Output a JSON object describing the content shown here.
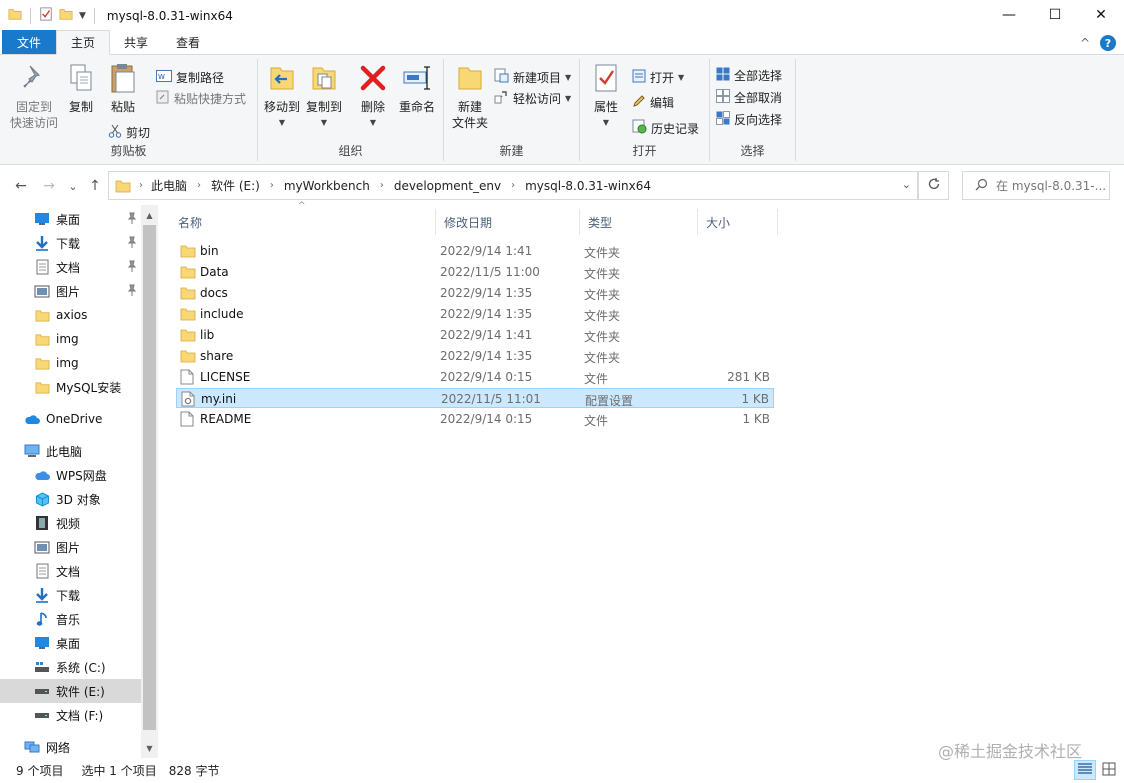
{
  "window": {
    "title": "mysql-8.0.31-winx64",
    "minimize": "—",
    "maximize": "☐",
    "close": "✕"
  },
  "tabs": {
    "file": "文件",
    "home": "主页",
    "share": "共享",
    "view": "查看",
    "collapse": "^",
    "help": "?"
  },
  "ribbon": {
    "clipboard": {
      "label": "剪贴板",
      "pin": "固定到快速访问",
      "pin_l1": "固定到",
      "pin_l2": "快速访问",
      "copy": "复制",
      "paste": "粘贴",
      "copy_path": "复制路径",
      "paste_shortcut": "粘贴快捷方式",
      "cut": "剪切"
    },
    "organize": {
      "label": "组织",
      "move_to": "移动到",
      "copy_to": "复制到",
      "delete": "删除",
      "rename": "重命名"
    },
    "new": {
      "label": "新建",
      "new_folder_l1": "新建",
      "new_folder_l2": "文件夹",
      "new_item": "新建项目",
      "easy_access": "轻松访问"
    },
    "open": {
      "label": "打开",
      "properties": "属性",
      "open": "打开",
      "edit": "编辑",
      "history": "历史记录"
    },
    "select": {
      "label": "选择",
      "select_all": "全部选择",
      "select_none": "全部取消",
      "invert": "反向选择"
    }
  },
  "address": {
    "back": "←",
    "forward": "→",
    "recent": "⌄",
    "up": "↑",
    "crumbs": [
      "此电脑",
      "软件 (E:)",
      "myWorkbench",
      "development_env",
      "mysql-8.0.31-winx64"
    ],
    "search_placeholder": "在 mysql-8.0.31-..."
  },
  "nav": {
    "quick": [
      "桌面",
      "下载",
      "文档",
      "图片",
      "axios",
      "img",
      "img",
      "MySQL安装"
    ],
    "onedrive": "OneDrive",
    "this_pc": "此电脑",
    "pc_items": [
      "WPS网盘",
      "3D 对象",
      "视频",
      "图片",
      "文档",
      "下载",
      "音乐",
      "桌面",
      "系统 (C:)",
      "软件 (E:)",
      "文档 (F:)"
    ],
    "network": "网络"
  },
  "columns": {
    "name": "名称",
    "date": "修改日期",
    "type": "类型",
    "size": "大小"
  },
  "files": [
    {
      "name": "bin",
      "date": "2022/9/14 1:41",
      "type": "文件夹",
      "size": "",
      "kind": "folder"
    },
    {
      "name": "Data",
      "date": "2022/11/5 11:00",
      "type": "文件夹",
      "size": "",
      "kind": "folder"
    },
    {
      "name": "docs",
      "date": "2022/9/14 1:35",
      "type": "文件夹",
      "size": "",
      "kind": "folder"
    },
    {
      "name": "include",
      "date": "2022/9/14 1:35",
      "type": "文件夹",
      "size": "",
      "kind": "folder"
    },
    {
      "name": "lib",
      "date": "2022/9/14 1:41",
      "type": "文件夹",
      "size": "",
      "kind": "folder"
    },
    {
      "name": "share",
      "date": "2022/9/14 1:35",
      "type": "文件夹",
      "size": "",
      "kind": "folder"
    },
    {
      "name": "LICENSE",
      "date": "2022/9/14 0:15",
      "type": "文件",
      "size": "281 KB",
      "kind": "file"
    },
    {
      "name": "my.ini",
      "date": "2022/11/5 11:01",
      "type": "配置设置",
      "size": "1 KB",
      "kind": "ini"
    },
    {
      "name": "README",
      "date": "2022/9/14 0:15",
      "type": "文件",
      "size": "1 KB",
      "kind": "file"
    }
  ],
  "status": {
    "count": "9 个项目",
    "selected": "选中 1 个项目",
    "size": "828 字节"
  },
  "watermark": "@稀土掘金技术社区",
  "colors": {
    "accent": "#1979ca",
    "selection": "#cce8ff",
    "folder": "#f8d775"
  }
}
